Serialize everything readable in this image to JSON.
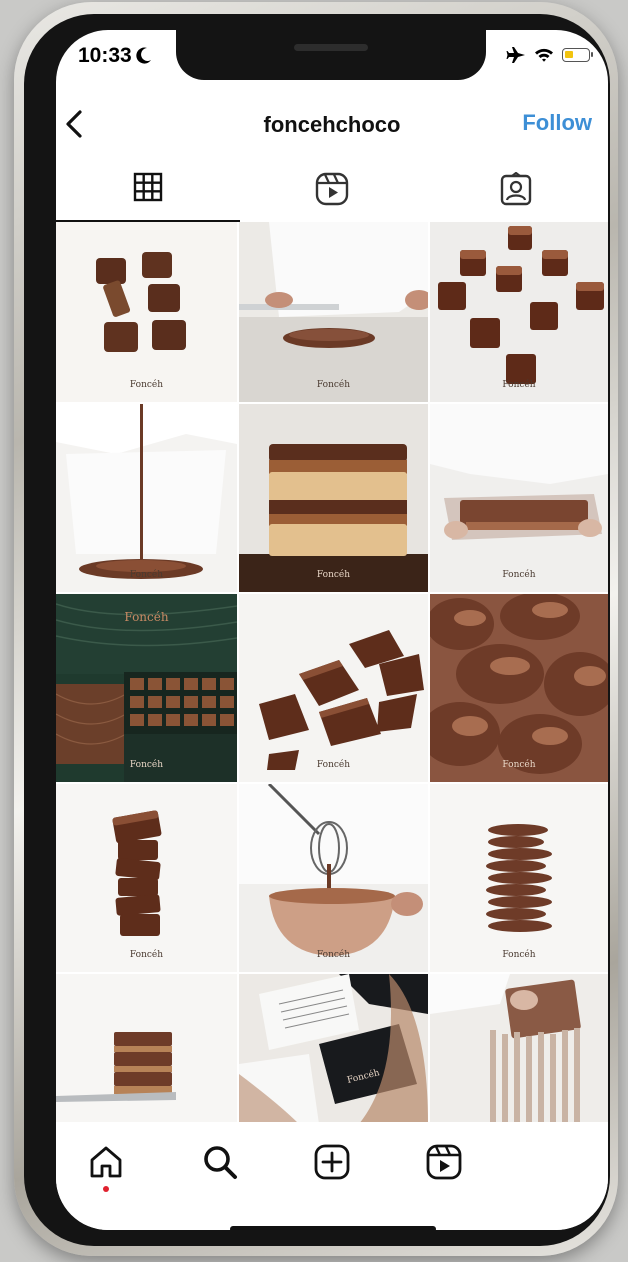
{
  "status_bar": {
    "time": "10:33"
  },
  "header": {
    "username": "foncehchoco",
    "follow_label": "Follow"
  },
  "tabs": [
    {
      "name": "grid",
      "icon": "grid-icon",
      "active": true
    },
    {
      "name": "reels",
      "icon": "reels-icon",
      "active": false
    },
    {
      "name": "tagged",
      "icon": "tagged-person-icon",
      "active": false
    }
  ],
  "grid_items": [
    {
      "brand": "Foncéh"
    },
    {
      "brand": "Foncéh"
    },
    {
      "brand": "Foncéh"
    },
    {
      "brand": "Foncéh"
    },
    {
      "brand": "Foncéh"
    },
    {
      "brand": "Foncéh"
    },
    {
      "brand": "Foncéh",
      "label": "Foncéh"
    },
    {
      "brand": "Foncéh"
    },
    {
      "brand": "Foncéh"
    },
    {
      "brand": "Foncéh"
    },
    {
      "brand": "Foncéh"
    },
    {
      "brand": "Foncéh"
    },
    {
      "brand": ""
    },
    {
      "brand": "Foncéh"
    },
    {
      "brand": ""
    }
  ],
  "bottom_nav": [
    {
      "name": "home",
      "icon": "home-icon"
    },
    {
      "name": "search",
      "icon": "search-icon"
    },
    {
      "name": "create",
      "icon": "add-post-icon"
    },
    {
      "name": "reels",
      "icon": "reels-icon"
    }
  ],
  "colors": {
    "follow": "#3d8fd6",
    "notification_dot": "#e0212e",
    "chocolate": "#6b3a26"
  }
}
